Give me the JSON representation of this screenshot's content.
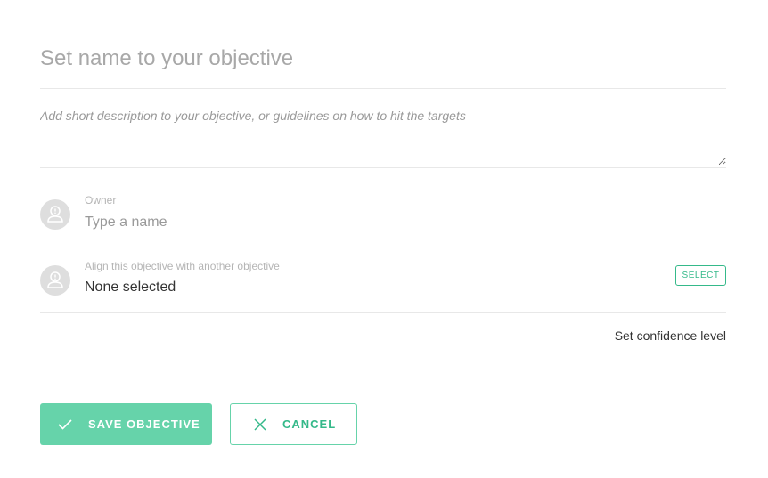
{
  "objective": {
    "name_placeholder": "Set name to your objective",
    "description_placeholder": "Add short description to your objective, or guidelines on how to hit the targets"
  },
  "owner": {
    "label": "Owner",
    "placeholder": "Type a name",
    "avatar_icon": "user-icon"
  },
  "alignment": {
    "label": "Align this objective with another objective",
    "value": "None selected",
    "select_label": "SELECT",
    "avatar_icon": "user-icon"
  },
  "confidence": {
    "link_label": "Set confidence level"
  },
  "actions": {
    "save_label": "SAVE OBJECTIVE",
    "save_icon": "check-icon",
    "cancel_label": "CANCEL",
    "cancel_icon": "close-icon"
  },
  "colors": {
    "accent": "#35b98a",
    "save_button_bg": "#66d3aa",
    "divider": "#e8e8e8",
    "avatar_bg": "#dedede"
  }
}
